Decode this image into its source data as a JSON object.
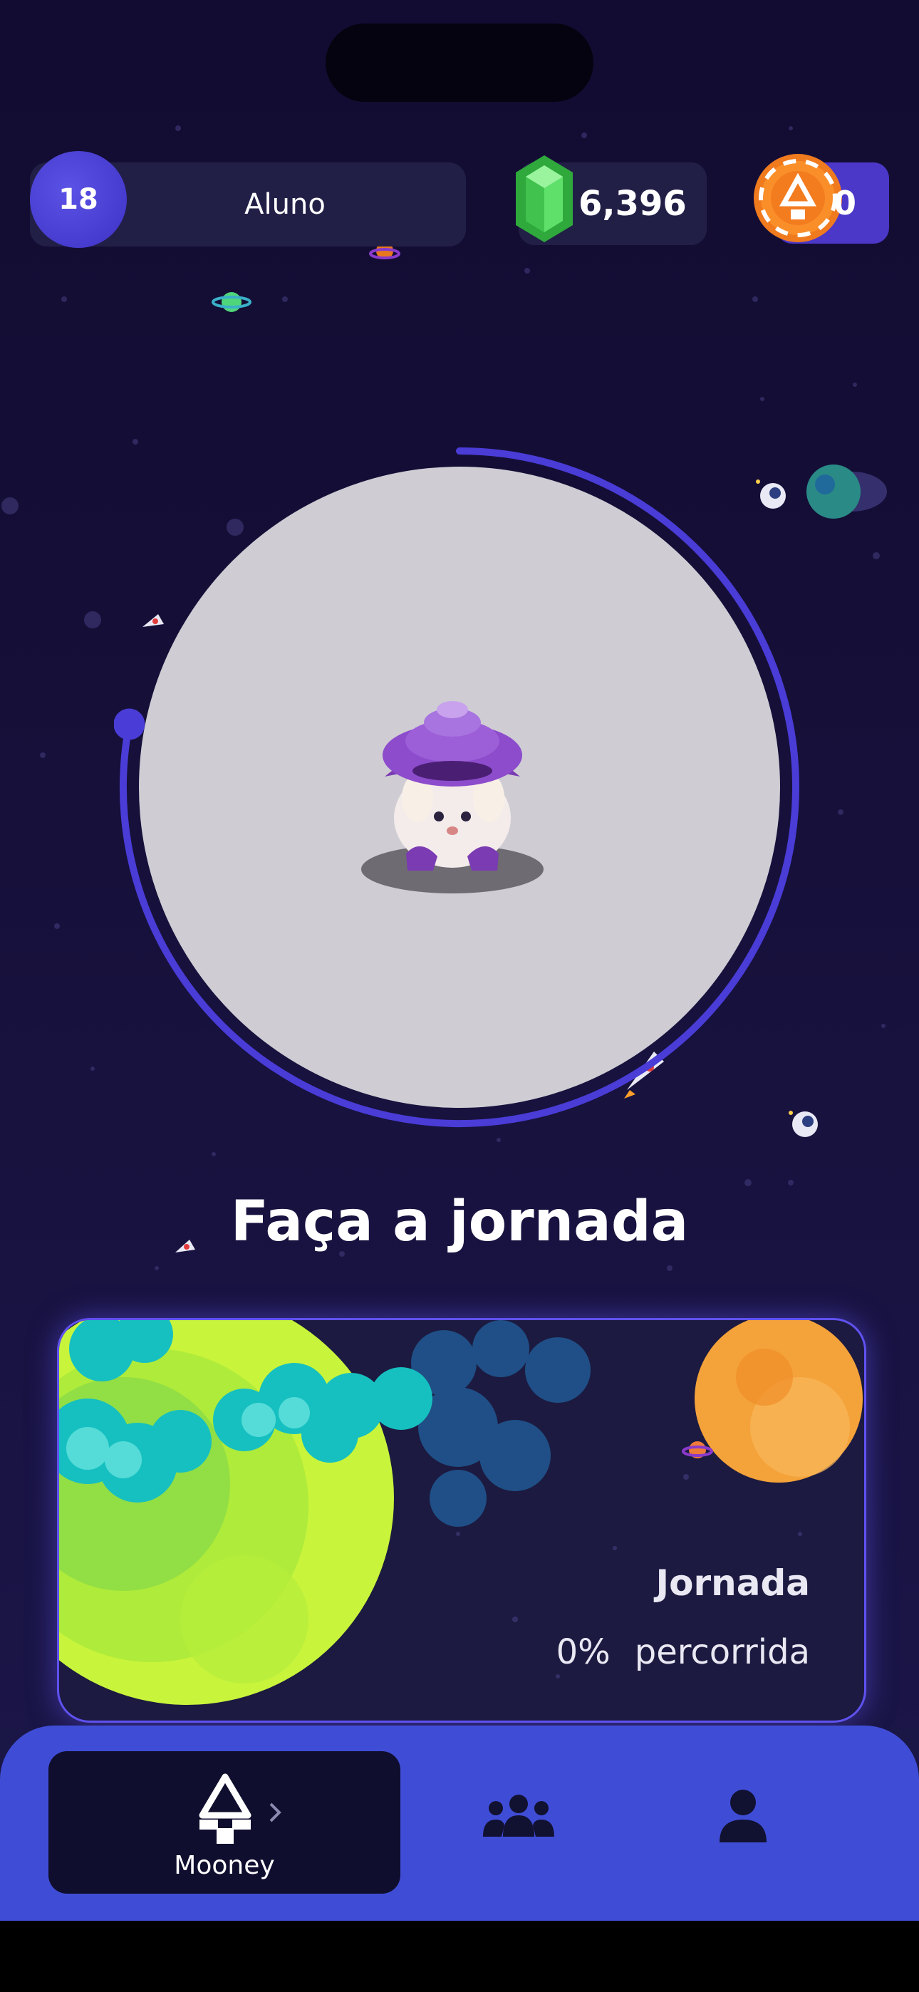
{
  "header": {
    "level": "18",
    "role": "Aluno",
    "gems": "6,396",
    "coins": "0"
  },
  "main": {
    "journey_title": "Faça a jornada",
    "journey_progress_fraction": 0.78
  },
  "journey_card": {
    "title": "Jornada",
    "progress_value": "0%",
    "progress_word": "percorrida"
  },
  "bottom_nav": {
    "items": [
      {
        "label": "Mooney",
        "icon": "mooney-logo-icon",
        "active": true
      },
      {
        "label": "",
        "icon": "community-icon",
        "active": false
      },
      {
        "label": "",
        "icon": "profile-icon",
        "active": false
      }
    ]
  },
  "colors": {
    "background": "#16103a",
    "accent": "#3f4dd6",
    "ring": "#4a3cd6",
    "gem": "#3ec94a",
    "coin": "#f07a1e"
  }
}
